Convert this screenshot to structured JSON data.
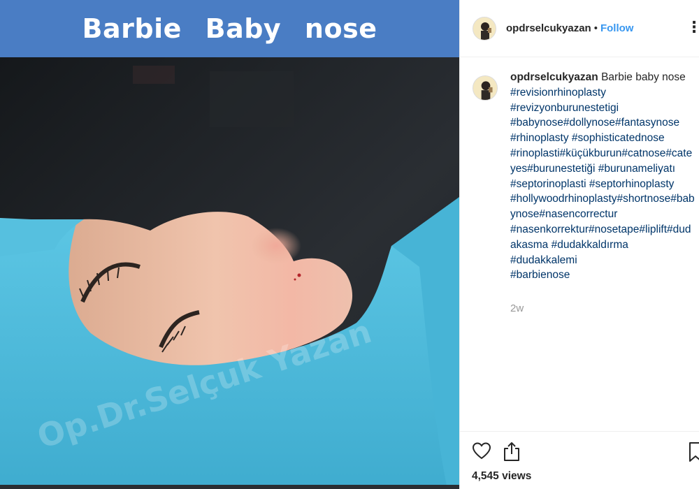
{
  "media": {
    "banner_text": "Barbie   Baby nose",
    "watermark": "Op.Dr.Selçuk Yazan"
  },
  "header": {
    "username": "opdrselcukyazan",
    "separator": "•",
    "follow_label": "Follow",
    "more_label": "⋮"
  },
  "caption": {
    "username": "opdrselcukyazan",
    "text": "Barbie baby nose",
    "hashtags": "#revisionrhinoplasty\n#revizyonburunestetigi\n#babynose#dollynose#fantasynose\n#rhinoplasty #sophisticatednose\n#rinoplasti#küçükburun#catnose#cate\nyes#burunestetiği #burunameliyatı\n#septorinoplasti #septorhinoplasty\n#hollywoodrhinoplasty#shortnose#bab\nynose#nasencorrectur\n#nasenkorrektur#nosetape#liplift#dud\nakasma #dudakkaldırma\n#dudakkalemi\n#barbienose",
    "time": "2w"
  },
  "actions": {
    "views": "4,545 views"
  },
  "colors": {
    "banner": "#4a7dc4",
    "drape": "#4fb9d9",
    "follow": "#3897f0",
    "hashtag": "#003569"
  }
}
